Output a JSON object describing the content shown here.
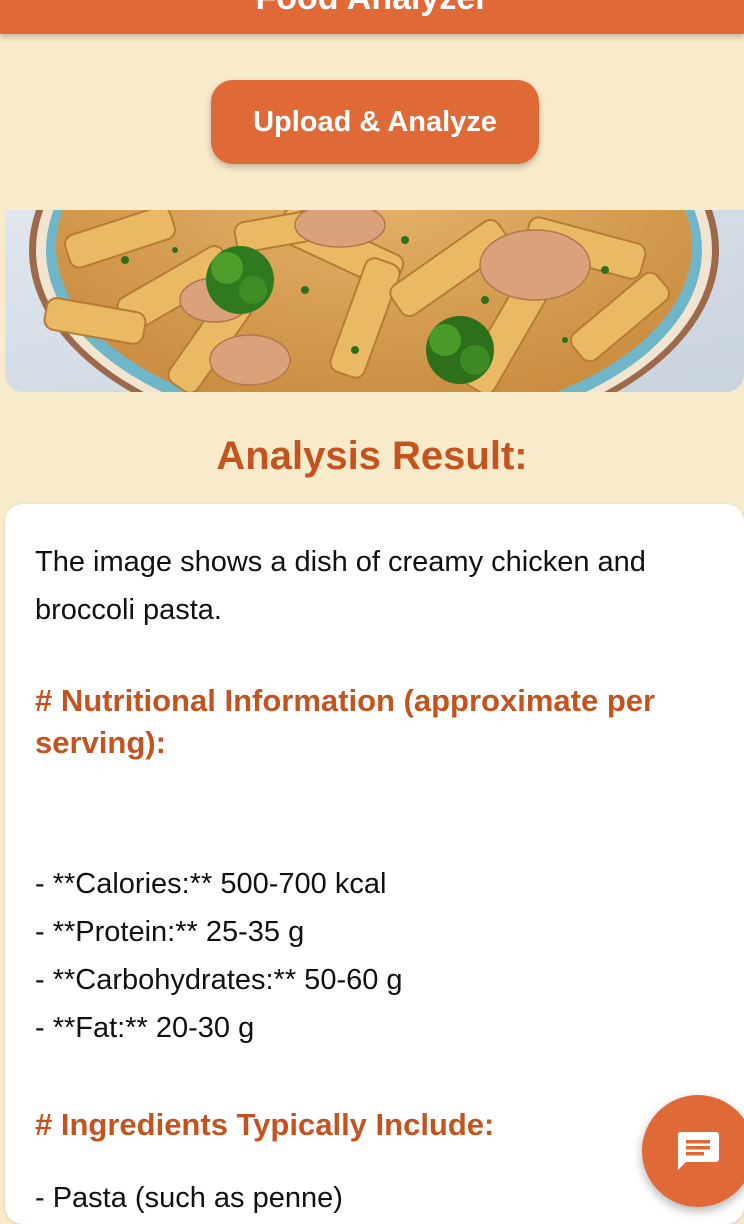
{
  "app_bar": {
    "title": "Food Analyzer",
    "color": "#e06a37"
  },
  "upload_button": {
    "label": "Upload & Analyze"
  },
  "food_image": {
    "description_icon": "pasta-photo"
  },
  "result": {
    "title": "Analysis Result:",
    "intro": "The image shows a dish of creamy chicken and broccoli pasta.",
    "nutrition_heading": "# Nutritional Information (approximate per serving):",
    "nutrition_items": [
      "- **Calories:** 500-700 kcal",
      "- **Protein:** 25-35 g",
      "- **Carbohydrates:** 50-60 g",
      "- **Fat:** 20-30 g"
    ],
    "ingredients_heading": "# Ingredients Typically Include:",
    "ingredient_items": [
      "- Pasta (such as penne)"
    ]
  },
  "chat_button": {
    "icon": "chat-icon"
  },
  "colors": {
    "background": "#f8ebcb",
    "accent": "#e06a37",
    "heading": "#c4541f"
  }
}
